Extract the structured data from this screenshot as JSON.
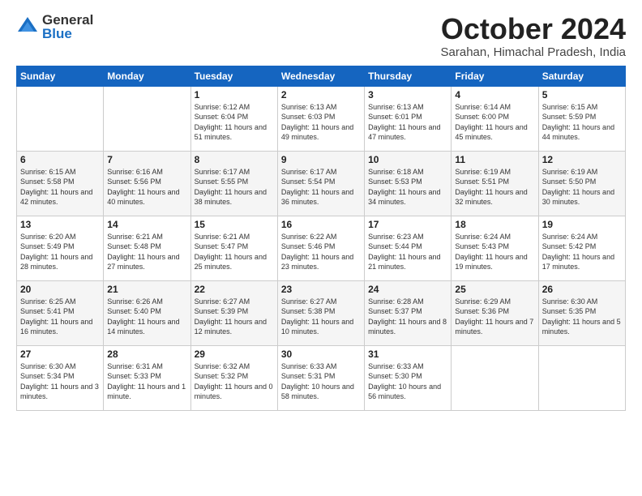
{
  "header": {
    "logo_general": "General",
    "logo_blue": "Blue",
    "month_title": "October 2024",
    "subtitle": "Sarahan, Himachal Pradesh, India"
  },
  "columns": [
    "Sunday",
    "Monday",
    "Tuesday",
    "Wednesday",
    "Thursday",
    "Friday",
    "Saturday"
  ],
  "weeks": [
    [
      {
        "day": "",
        "content": ""
      },
      {
        "day": "",
        "content": ""
      },
      {
        "day": "1",
        "content": "Sunrise: 6:12 AM\nSunset: 6:04 PM\nDaylight: 11 hours and 51 minutes."
      },
      {
        "day": "2",
        "content": "Sunrise: 6:13 AM\nSunset: 6:03 PM\nDaylight: 11 hours and 49 minutes."
      },
      {
        "day": "3",
        "content": "Sunrise: 6:13 AM\nSunset: 6:01 PM\nDaylight: 11 hours and 47 minutes."
      },
      {
        "day": "4",
        "content": "Sunrise: 6:14 AM\nSunset: 6:00 PM\nDaylight: 11 hours and 45 minutes."
      },
      {
        "day": "5",
        "content": "Sunrise: 6:15 AM\nSunset: 5:59 PM\nDaylight: 11 hours and 44 minutes."
      }
    ],
    [
      {
        "day": "6",
        "content": "Sunrise: 6:15 AM\nSunset: 5:58 PM\nDaylight: 11 hours and 42 minutes."
      },
      {
        "day": "7",
        "content": "Sunrise: 6:16 AM\nSunset: 5:56 PM\nDaylight: 11 hours and 40 minutes."
      },
      {
        "day": "8",
        "content": "Sunrise: 6:17 AM\nSunset: 5:55 PM\nDaylight: 11 hours and 38 minutes."
      },
      {
        "day": "9",
        "content": "Sunrise: 6:17 AM\nSunset: 5:54 PM\nDaylight: 11 hours and 36 minutes."
      },
      {
        "day": "10",
        "content": "Sunrise: 6:18 AM\nSunset: 5:53 PM\nDaylight: 11 hours and 34 minutes."
      },
      {
        "day": "11",
        "content": "Sunrise: 6:19 AM\nSunset: 5:51 PM\nDaylight: 11 hours and 32 minutes."
      },
      {
        "day": "12",
        "content": "Sunrise: 6:19 AM\nSunset: 5:50 PM\nDaylight: 11 hours and 30 minutes."
      }
    ],
    [
      {
        "day": "13",
        "content": "Sunrise: 6:20 AM\nSunset: 5:49 PM\nDaylight: 11 hours and 28 minutes."
      },
      {
        "day": "14",
        "content": "Sunrise: 6:21 AM\nSunset: 5:48 PM\nDaylight: 11 hours and 27 minutes."
      },
      {
        "day": "15",
        "content": "Sunrise: 6:21 AM\nSunset: 5:47 PM\nDaylight: 11 hours and 25 minutes."
      },
      {
        "day": "16",
        "content": "Sunrise: 6:22 AM\nSunset: 5:46 PM\nDaylight: 11 hours and 23 minutes."
      },
      {
        "day": "17",
        "content": "Sunrise: 6:23 AM\nSunset: 5:44 PM\nDaylight: 11 hours and 21 minutes."
      },
      {
        "day": "18",
        "content": "Sunrise: 6:24 AM\nSunset: 5:43 PM\nDaylight: 11 hours and 19 minutes."
      },
      {
        "day": "19",
        "content": "Sunrise: 6:24 AM\nSunset: 5:42 PM\nDaylight: 11 hours and 17 minutes."
      }
    ],
    [
      {
        "day": "20",
        "content": "Sunrise: 6:25 AM\nSunset: 5:41 PM\nDaylight: 11 hours and 16 minutes."
      },
      {
        "day": "21",
        "content": "Sunrise: 6:26 AM\nSunset: 5:40 PM\nDaylight: 11 hours and 14 minutes."
      },
      {
        "day": "22",
        "content": "Sunrise: 6:27 AM\nSunset: 5:39 PM\nDaylight: 11 hours and 12 minutes."
      },
      {
        "day": "23",
        "content": "Sunrise: 6:27 AM\nSunset: 5:38 PM\nDaylight: 11 hours and 10 minutes."
      },
      {
        "day": "24",
        "content": "Sunrise: 6:28 AM\nSunset: 5:37 PM\nDaylight: 11 hours and 8 minutes."
      },
      {
        "day": "25",
        "content": "Sunrise: 6:29 AM\nSunset: 5:36 PM\nDaylight: 11 hours and 7 minutes."
      },
      {
        "day": "26",
        "content": "Sunrise: 6:30 AM\nSunset: 5:35 PM\nDaylight: 11 hours and 5 minutes."
      }
    ],
    [
      {
        "day": "27",
        "content": "Sunrise: 6:30 AM\nSunset: 5:34 PM\nDaylight: 11 hours and 3 minutes."
      },
      {
        "day": "28",
        "content": "Sunrise: 6:31 AM\nSunset: 5:33 PM\nDaylight: 11 hours and 1 minute."
      },
      {
        "day": "29",
        "content": "Sunrise: 6:32 AM\nSunset: 5:32 PM\nDaylight: 11 hours and 0 minutes."
      },
      {
        "day": "30",
        "content": "Sunrise: 6:33 AM\nSunset: 5:31 PM\nDaylight: 10 hours and 58 minutes."
      },
      {
        "day": "31",
        "content": "Sunrise: 6:33 AM\nSunset: 5:30 PM\nDaylight: 10 hours and 56 minutes."
      },
      {
        "day": "",
        "content": ""
      },
      {
        "day": "",
        "content": ""
      }
    ]
  ]
}
